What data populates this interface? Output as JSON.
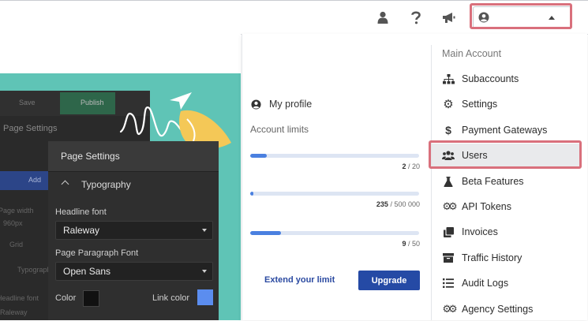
{
  "topbar": {
    "icons": [
      "user-icon",
      "help-icon",
      "announcement-icon",
      "account-circle-icon"
    ]
  },
  "editor_preview": {
    "toolbar_save": "Save",
    "toolbar_publish": "Publish",
    "back_title": "Page Settings",
    "back_button": "Add",
    "ghost_page_width": "Page width",
    "ghost_width_value": "960px",
    "ghost_grid": "Grid",
    "ghost_typography": "Typography",
    "ghost_headline_font": "Headline font",
    "ghost_headline_value": "Raleway",
    "panel_title": "Page Settings",
    "section_label": "Typography",
    "headline_font_label": "Headline font",
    "headline_font_value": "Raleway",
    "paragraph_font_label": "Page Paragraph Font",
    "paragraph_font_value": "Open Sans",
    "color_label": "Color",
    "link_color_label": "Link color",
    "color_value": "#111111",
    "link_color_value": "#5b8def"
  },
  "profile": {
    "my_profile": "My profile",
    "limits_title": "Account limits",
    "limits": [
      {
        "used": "2",
        "total": " / 20",
        "fraction": 0.1
      },
      {
        "used": "235",
        "total": " / 500 000",
        "fraction": 0.02
      },
      {
        "used": "9",
        "total": " / 50",
        "fraction": 0.18
      }
    ],
    "extend_label": "Extend your limit",
    "upgrade_label": "Upgrade"
  },
  "main_account": {
    "title": "Main Account",
    "items": [
      {
        "label": "Subaccounts",
        "icon": "sitemap-icon"
      },
      {
        "label": "Settings",
        "icon": "gear-icon"
      },
      {
        "label": "Payment Gateways",
        "icon": "dollar-icon"
      },
      {
        "label": "Users",
        "icon": "users-icon"
      },
      {
        "label": "Beta Features",
        "icon": "flask-icon"
      },
      {
        "label": "API Tokens",
        "icon": "gears-icon"
      },
      {
        "label": "Invoices",
        "icon": "copy-icon"
      },
      {
        "label": "Traffic History",
        "icon": "archive-icon"
      },
      {
        "label": "Audit Logs",
        "icon": "list-icon"
      },
      {
        "label": "Agency Settings",
        "icon": "gears-icon"
      }
    ]
  },
  "colors": {
    "hero_teal": "#5fc4b6",
    "highlight": "#d9707c",
    "primary_blue": "#254aa5",
    "progress_blue": "#4a80e0"
  }
}
